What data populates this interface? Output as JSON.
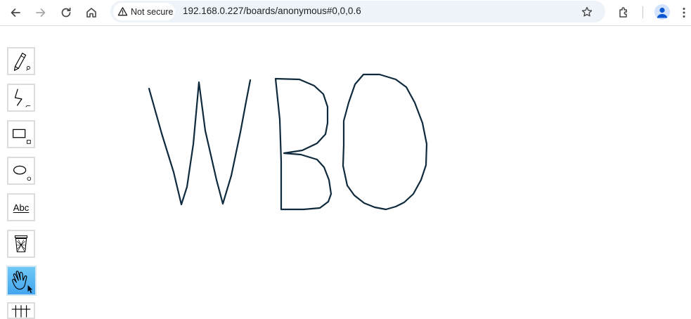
{
  "browser": {
    "security_label": "Not secure",
    "url": "192.168.0.227/boards/anonymous#0,0,0.6",
    "icons": {
      "back": "back-arrow-icon",
      "forward": "forward-arrow-icon",
      "reload": "reload-icon",
      "home": "home-icon",
      "warning": "warning-triangle-icon",
      "bookmark": "star-icon",
      "extensions": "puzzle-icon",
      "profile": "profile-avatar-icon",
      "menu": "kebab-menu-icon"
    }
  },
  "toolbar": {
    "tools": [
      {
        "id": "pencil",
        "icon": "pencil-icon"
      },
      {
        "id": "line",
        "icon": "zigzag-line-icon"
      },
      {
        "id": "rectangle",
        "icon": "rectangle-icon"
      },
      {
        "id": "ellipse",
        "icon": "ellipse-icon"
      },
      {
        "id": "text",
        "icon": "text-tool-icon",
        "label": "Abc"
      },
      {
        "id": "clear",
        "icon": "trash-bin-icon"
      },
      {
        "id": "hand",
        "icon": "hand-icon",
        "active": true
      },
      {
        "id": "grid",
        "icon": "grid-icon"
      }
    ],
    "active_color": "#44a5ef"
  },
  "canvas": {
    "drawn_text": "WBO",
    "stroke_color": "#0f2a3d"
  }
}
